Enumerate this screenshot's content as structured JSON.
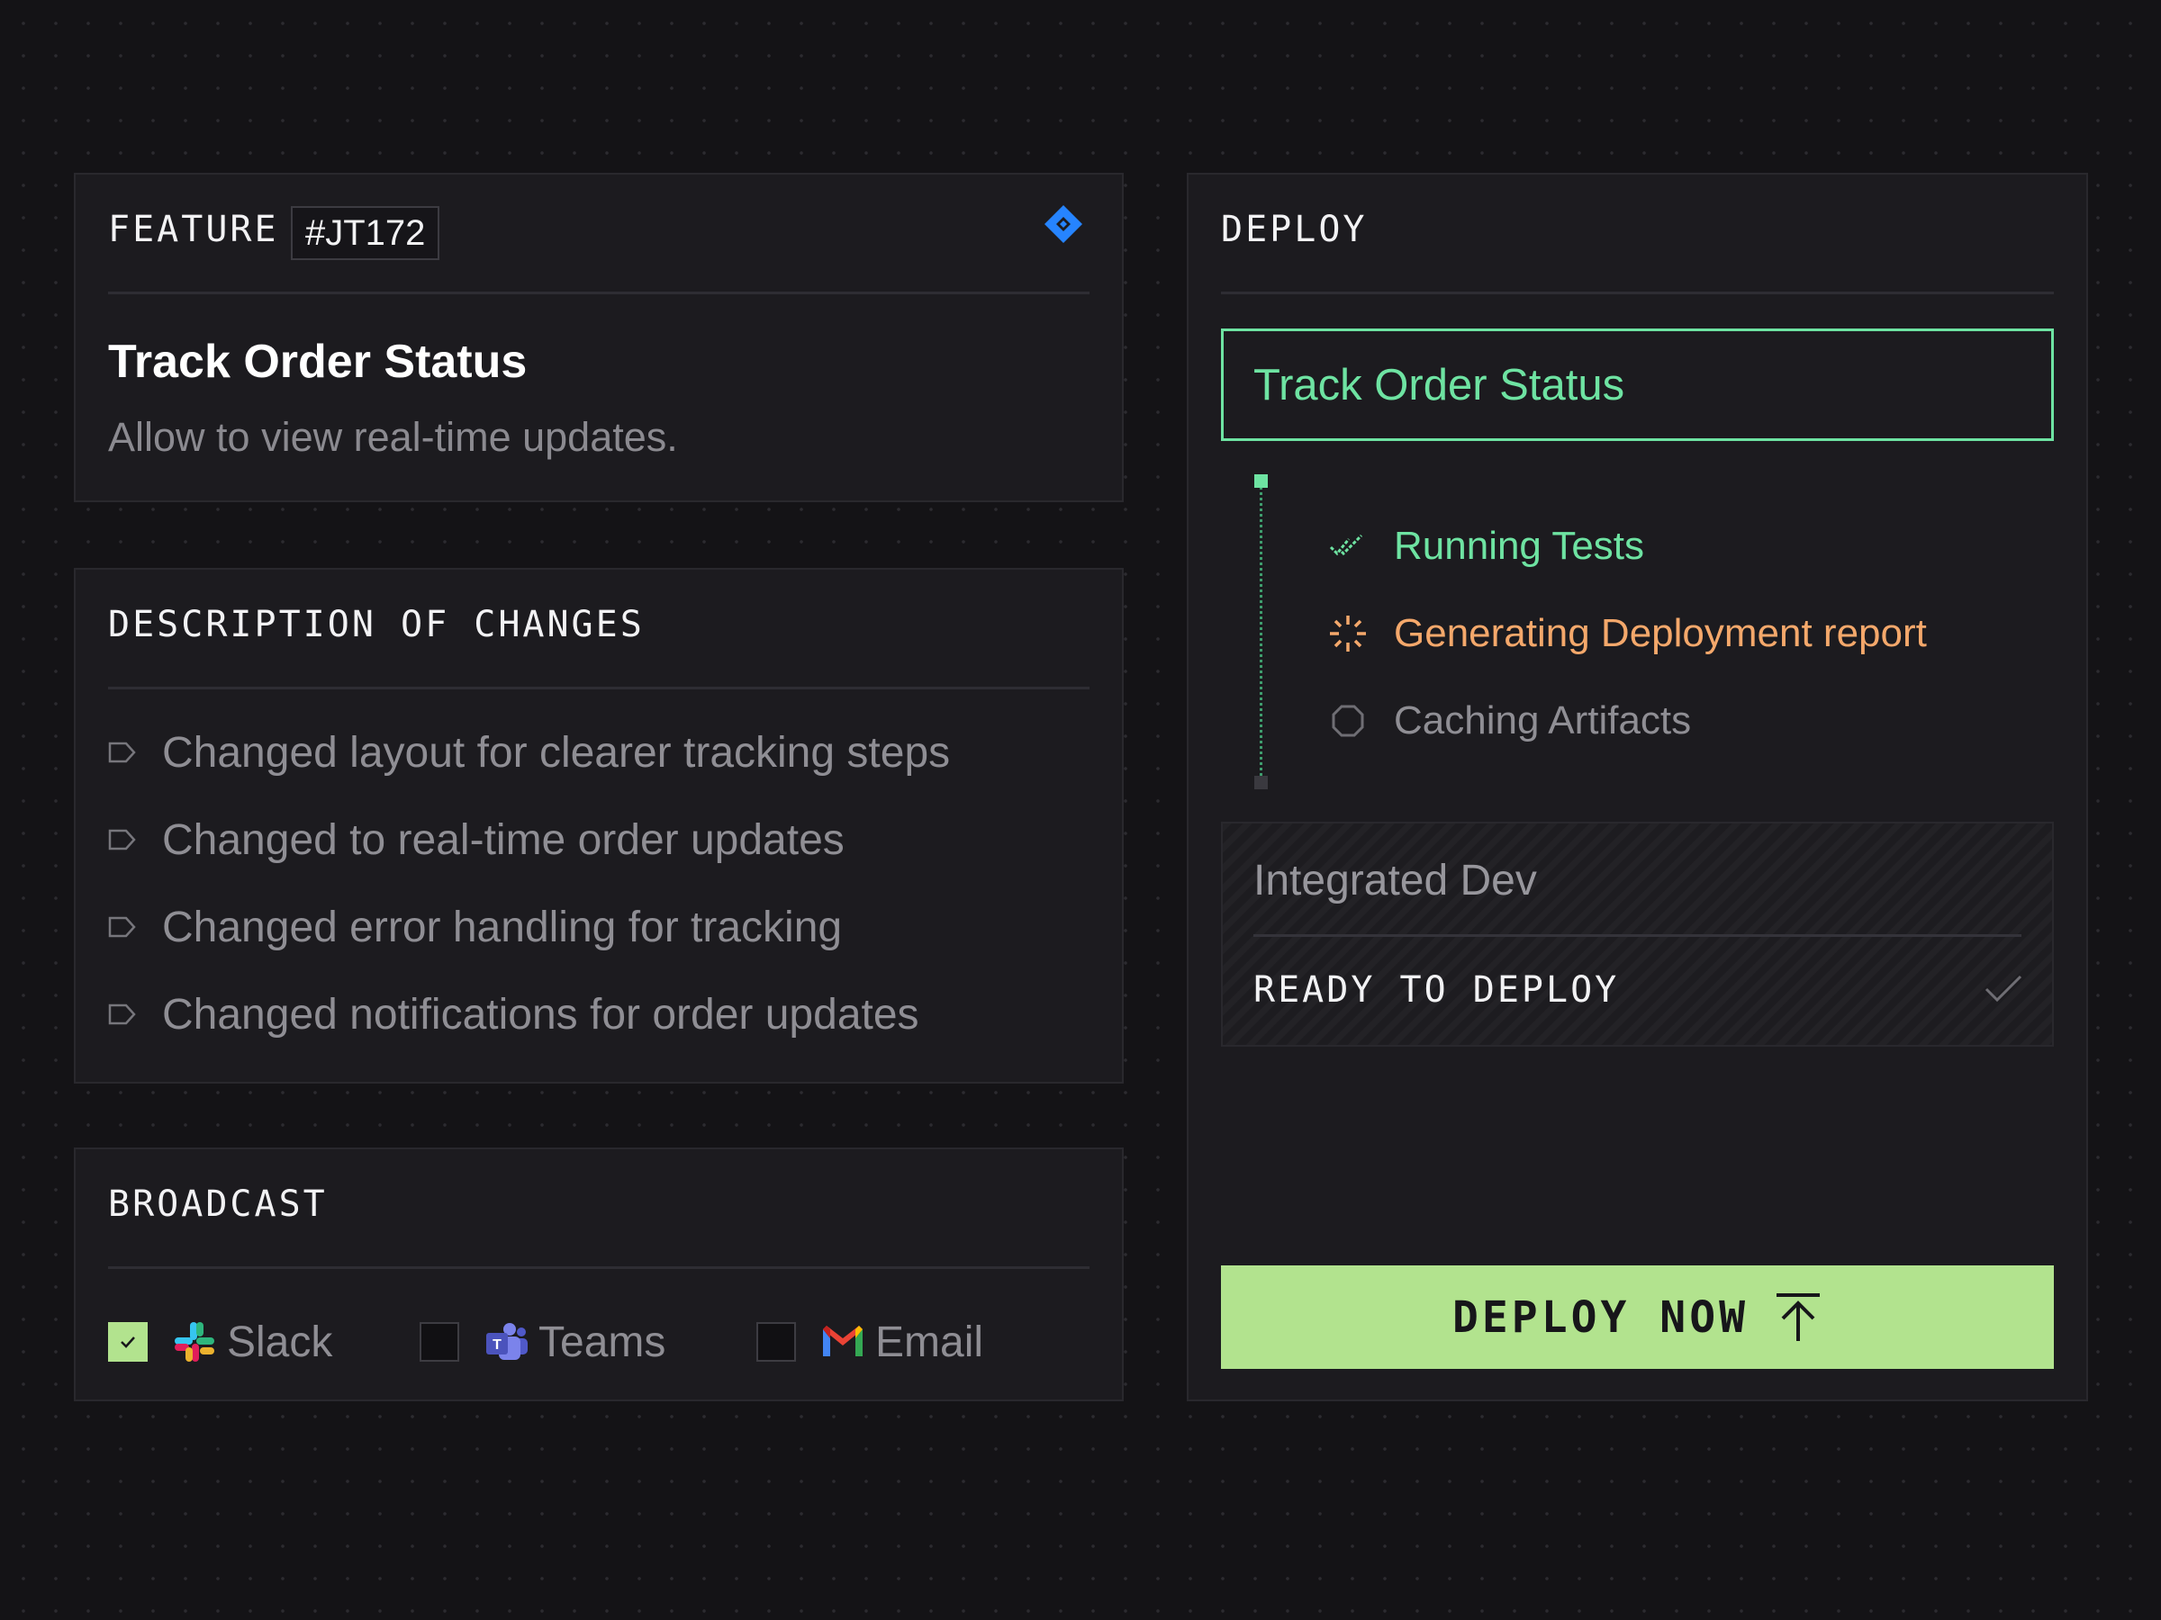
{
  "feature": {
    "heading": "FEATURE",
    "ticket": "#JT172",
    "tracker_icon": "jira-icon",
    "title": "Track Order Status",
    "subtitle": "Allow to view real-time updates."
  },
  "changes": {
    "heading": "DESCRIPTION OF CHANGES",
    "items": [
      "Changed layout for clearer tracking steps",
      "Changed to real-time order updates",
      "Changed error handling for tracking",
      "Changed notifications for order updates"
    ]
  },
  "broadcast": {
    "heading": "BROADCAST",
    "channels": [
      {
        "label": "Slack",
        "checked": true,
        "icon": "slack-icon"
      },
      {
        "label": "Teams",
        "checked": false,
        "icon": "teams-icon"
      },
      {
        "label": "Email",
        "checked": false,
        "icon": "gmail-icon"
      }
    ]
  },
  "deploy": {
    "heading": "DEPLOY",
    "target": "Track Order Status",
    "steps": [
      {
        "label": "Running Tests",
        "state": "done",
        "color": "#6ee3a2",
        "icon": "double-check-icon"
      },
      {
        "label": "Generating Deployment report",
        "state": "in-progress",
        "color": "#f4a86b",
        "icon": "spinner-icon"
      },
      {
        "label": "Caching Artifacts",
        "state": "pending",
        "color": "#8f8e94",
        "icon": "pending-circle-icon"
      }
    ],
    "environment": {
      "name": "Integrated Dev",
      "status": "READY TO DEPLOY",
      "status_icon": "check-icon"
    },
    "button": {
      "label": "DEPLOY NOW",
      "icon": "upload-arrow-icon"
    }
  },
  "colors": {
    "accent_green": "#6ee3a2",
    "button_green": "#b2e38e",
    "progress_orange": "#f4a86b",
    "jira_blue": "#2684ff"
  }
}
